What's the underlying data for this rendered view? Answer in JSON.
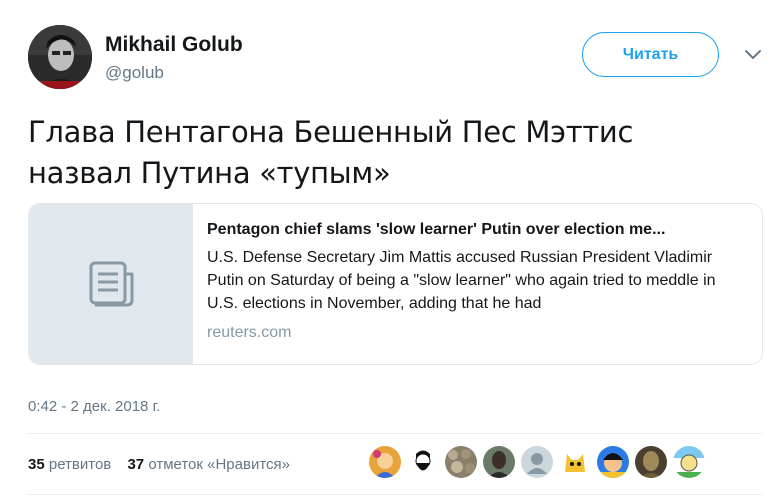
{
  "user": {
    "name": "Mikhail Golub",
    "handle": "@golub"
  },
  "follow_button": "Читать",
  "tweet": {
    "text_line1": "Глава Пентагона Бешенный Пес Мэттис",
    "text_line2": "назвал Путина «тупым»"
  },
  "card": {
    "title": "Pentagon chief slams 'slow learner' Putin over election me...",
    "description": "U.S. Defense Secretary Jim Mattis accused Russian President Vladimir Putin on Saturday of being a \"slow learner\" who again tried to meddle in U.S. elections in November, adding that he had",
    "domain": "reuters.com",
    "media_icon": "document-icon"
  },
  "timestamp": "0:42 - 2 дек. 2018 г.",
  "stats": {
    "retweets_count": "35",
    "retweets_label": "ретвитов",
    "likes_count": "37",
    "likes_label": "отметок «Нравится»"
  },
  "likers": [
    {
      "icon": "avatar-colorful"
    },
    {
      "icon": "avatar-bearded"
    },
    {
      "icon": "avatar-pebbles"
    },
    {
      "icon": "avatar-portrait"
    },
    {
      "icon": "avatar-default"
    },
    {
      "icon": "avatar-cartoon-cat"
    },
    {
      "icon": "avatar-cartoon-boy"
    },
    {
      "icon": "avatar-statue"
    },
    {
      "icon": "avatar-doodle"
    }
  ],
  "colors": {
    "accent": "#1da1f2",
    "secondary_text": "#657786",
    "card_media_bg": "#e1e8ed"
  }
}
